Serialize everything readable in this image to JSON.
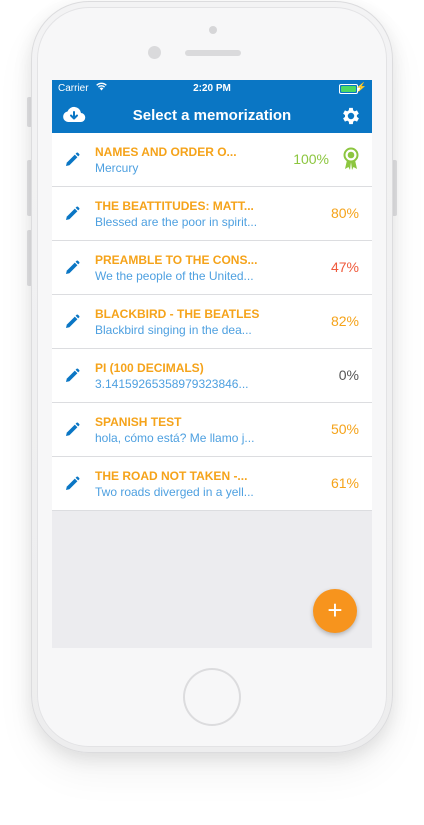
{
  "status_bar": {
    "carrier": "Carrier",
    "time": "2:20 PM"
  },
  "nav": {
    "title": "Select a memorization",
    "left_icon": "cloud-download-icon",
    "right_icon": "gear-icon"
  },
  "colors": {
    "header": "#0a76c4",
    "title": "#f5a31a",
    "subtitle": "#4ea0e0",
    "pct_green": "#8cc63f",
    "pct_orange": "#f5a31a",
    "pct_red": "#ef5a3c",
    "pct_gray": "#555555",
    "fab": "#f7941d"
  },
  "items": [
    {
      "title": "NAMES AND ORDER O...",
      "subtitle": "Mercury",
      "percent": "100%",
      "color": "#8cc63f",
      "award": true
    },
    {
      "title": "THE BEATTITUDES: MATT...",
      "subtitle": "Blessed are the poor in spirit...",
      "percent": "80%",
      "color": "#f5a31a",
      "award": false
    },
    {
      "title": "PREAMBLE TO THE CONS...",
      "subtitle": "We the people of the United...",
      "percent": "47%",
      "color": "#ef5a3c",
      "award": false
    },
    {
      "title": "BLACKBIRD - THE BEATLES",
      "subtitle": "Blackbird singing in the dea...",
      "percent": "82%",
      "color": "#f5a31a",
      "award": false
    },
    {
      "title": "PI (100 DECIMALS)",
      "subtitle": "3.14159265358979323846...",
      "percent": "0%",
      "color": "#555555",
      "award": false
    },
    {
      "title": "SPANISH TEST",
      "subtitle": "hola, cómo está? Me llamo j...",
      "percent": "50%",
      "color": "#f5a31a",
      "award": false
    },
    {
      "title": "THE ROAD NOT TAKEN -...",
      "subtitle": "Two roads diverged in a yell...",
      "percent": "61%",
      "color": "#f5a31a",
      "award": false
    }
  ],
  "fab": {
    "label": "+"
  }
}
